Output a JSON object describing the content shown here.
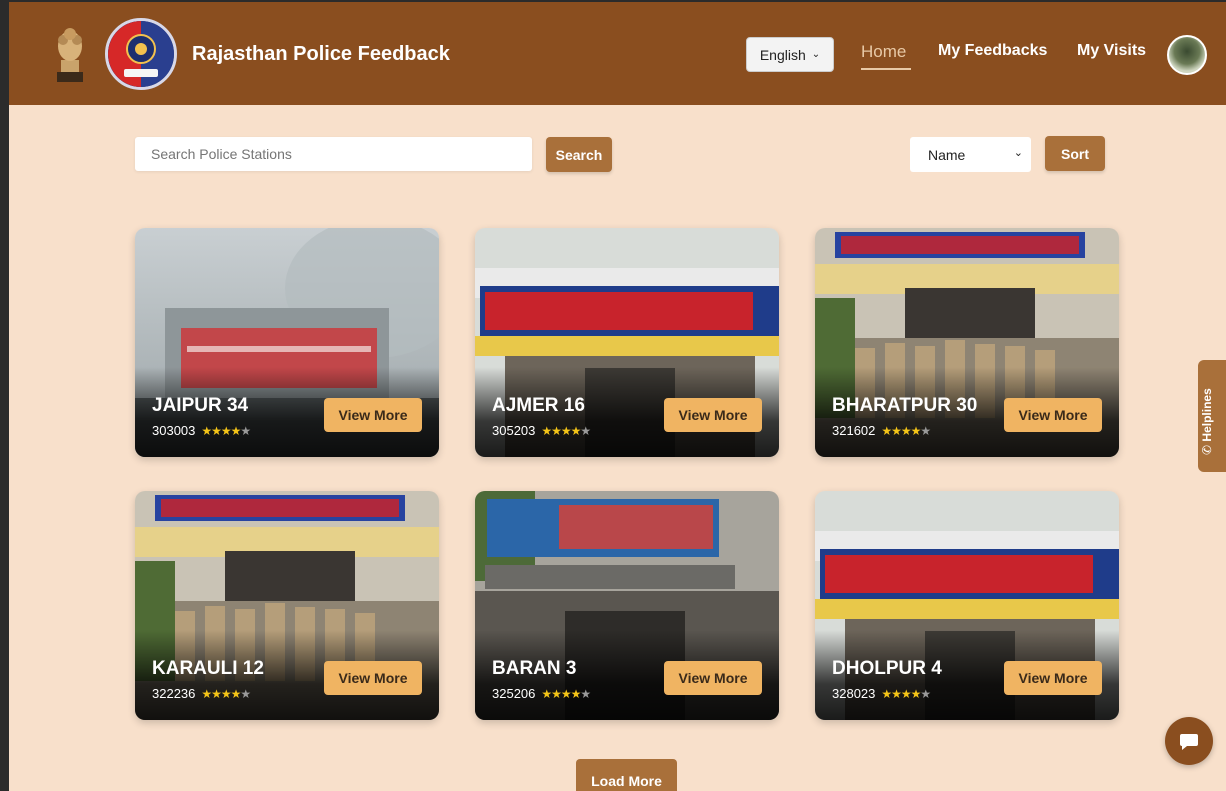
{
  "header": {
    "title": "Rajasthan Police Feedback",
    "language": "English",
    "nav": {
      "home": "Home",
      "my_feedbacks": "My Feedbacks",
      "my_visits": "My Visits"
    }
  },
  "toolbar": {
    "search_placeholder": "Search Police Stations",
    "search_label": "Search",
    "sort_selected": "Name",
    "sort_label": "Sort"
  },
  "stations": [
    {
      "name": "JAIPUR 34",
      "pin": "303003",
      "rating": 4,
      "view_label": "View More"
    },
    {
      "name": "AJMER 16",
      "pin": "305203",
      "rating": 4,
      "view_label": "View More"
    },
    {
      "name": "BHARATPUR 30",
      "pin": "321602",
      "rating": 4,
      "view_label": "View More"
    },
    {
      "name": "KARAULI 12",
      "pin": "322236",
      "rating": 4,
      "view_label": "View More"
    },
    {
      "name": "BARAN 3",
      "pin": "325206",
      "rating": 4,
      "view_label": "View More"
    },
    {
      "name": "DHOLPUR 4",
      "pin": "328023",
      "rating": 4,
      "view_label": "View More"
    }
  ],
  "load_more_label": "Load More",
  "helplines_label": "Helplines",
  "colors": {
    "navbar": "#8a4e1f",
    "page_bg": "#f8e0cb",
    "button": "#a9703a",
    "card_button": "#f0b462",
    "star": "#f5c518"
  }
}
